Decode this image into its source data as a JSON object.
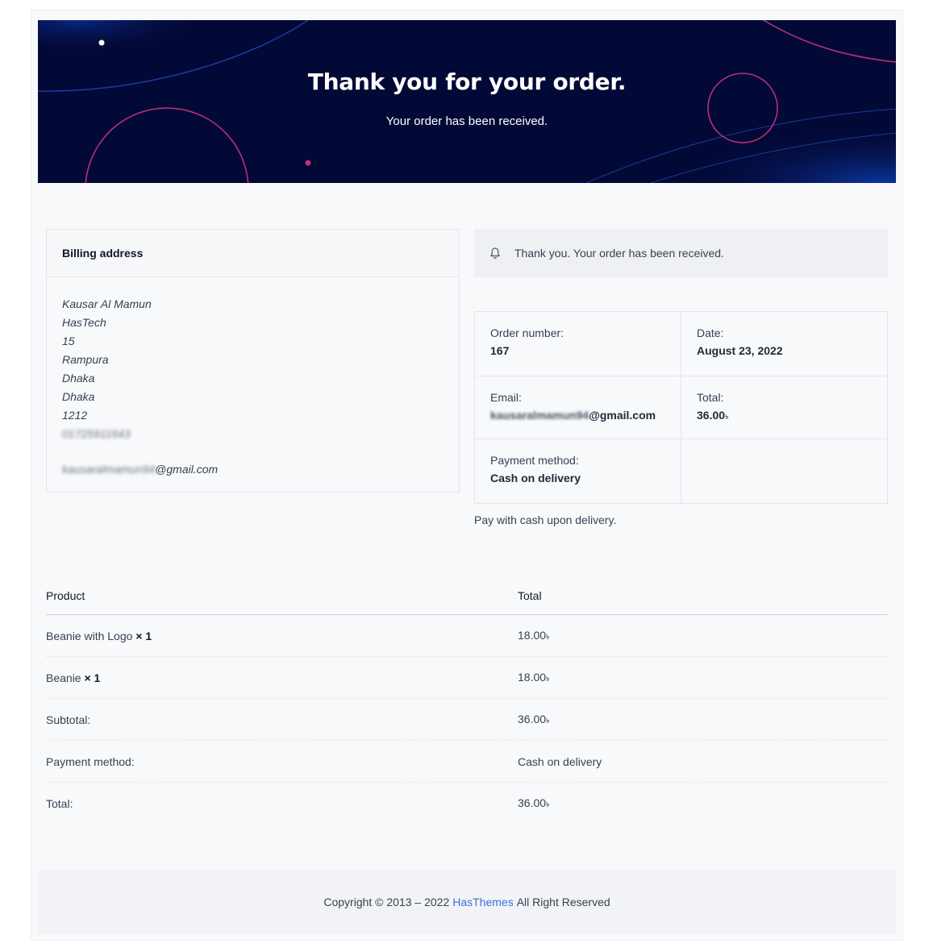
{
  "banner": {
    "title": "Thank you for your order.",
    "subtitle": "Your order has been received."
  },
  "billing": {
    "heading": "Billing address",
    "lines": [
      "Kausar Al Mamun",
      "HasTech",
      "15",
      "Rampura",
      "Dhaka",
      "Dhaka",
      "1212",
      "01725911643"
    ],
    "email_prefix": "kausaralmamun94",
    "email_domain": "@gmail.com"
  },
  "notice": {
    "icon": "bell-icon",
    "text": "Thank you. Your order has been received."
  },
  "overview": {
    "order_number_label": "Order number:",
    "order_number": "167",
    "date_label": "Date:",
    "date": "August 23, 2022",
    "email_label": "Email:",
    "email_prefix": "kausaralmamun94",
    "email_domain": "@gmail.com",
    "total_label": "Total:",
    "total": "36.00",
    "payment_label": "Payment method:",
    "payment": "Cash on delivery"
  },
  "payment_note": "Pay with cash upon delivery.",
  "currency_symbol": "৳",
  "products_table": {
    "headers": [
      "Product",
      "Total"
    ],
    "items": [
      {
        "name": "Beanie with Logo",
        "qty": "× 1",
        "total": "18.00"
      },
      {
        "name": "Beanie",
        "qty": "× 1",
        "total": "18.00"
      }
    ],
    "subtotal_label": "Subtotal:",
    "subtotal": "36.00",
    "payment_label": "Payment method:",
    "payment": "Cash on delivery",
    "total_label": "Total:",
    "total": "36.00"
  },
  "footer": {
    "prefix": "Copyright © 2013 – 2022",
    "link": "HasThemes",
    "suffix": "All Right Reserved"
  },
  "colors": {
    "banner_bg": "#030936",
    "accent_pink": "#c2307a",
    "link_blue": "#3b6fd9"
  }
}
